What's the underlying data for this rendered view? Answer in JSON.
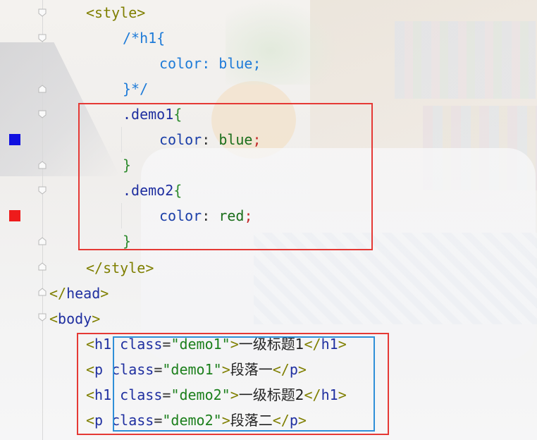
{
  "colors": {
    "red_box": "#e53935",
    "blue_box": "#2f8fd8",
    "blue_swatch": "#1010e0",
    "red_swatch": "#ee1b1b"
  },
  "code_lines": [
    {
      "parts": [
        {
          "t": "<",
          "c": "tag"
        },
        {
          "t": "style",
          "c": "tag"
        },
        {
          "t": ">",
          "c": "tag"
        }
      ]
    },
    {
      "parts": [
        {
          "t": "/*h1{",
          "c": "kw"
        }
      ]
    },
    {
      "parts": [
        {
          "t": "color: blue;",
          "c": "kw"
        }
      ]
    },
    {
      "parts": [
        {
          "t": "}*/",
          "c": "kw"
        }
      ]
    },
    {
      "parts": [
        {
          "t": ".demo1",
          "c": "sel"
        },
        {
          "t": "{",
          "c": "brace"
        }
      ]
    },
    {
      "parts": [
        {
          "t": "color",
          "c": "prop"
        },
        {
          "t": ": ",
          "c": "punc"
        },
        {
          "t": "blue",
          "c": "val"
        },
        {
          "t": ";",
          "c": "semi"
        }
      ]
    },
    {
      "parts": [
        {
          "t": "}",
          "c": "brace"
        }
      ]
    },
    {
      "parts": [
        {
          "t": ".demo2",
          "c": "sel"
        },
        {
          "t": "{",
          "c": "brace"
        }
      ]
    },
    {
      "parts": [
        {
          "t": "color",
          "c": "prop"
        },
        {
          "t": ": ",
          "c": "punc"
        },
        {
          "t": "red",
          "c": "val"
        },
        {
          "t": ";",
          "c": "semi"
        }
      ]
    },
    {
      "parts": [
        {
          "t": "}",
          "c": "brace"
        }
      ]
    },
    {
      "parts": [
        {
          "t": "</",
          "c": "tag"
        },
        {
          "t": "style",
          "c": "tag"
        },
        {
          "t": ">",
          "c": "tag"
        }
      ]
    },
    {
      "parts": [
        {
          "t": "</",
          "c": "tag"
        },
        {
          "t": "head",
          "c": "attr"
        },
        {
          "t": ">",
          "c": "tag"
        }
      ]
    },
    {
      "parts": [
        {
          "t": "<",
          "c": "tag"
        },
        {
          "t": "body",
          "c": "attr"
        },
        {
          "t": ">",
          "c": "tag"
        }
      ]
    },
    {
      "parts": [
        {
          "t": "<",
          "c": "tag"
        },
        {
          "t": "h1",
          "c": "attr"
        },
        {
          "t": " class",
          "c": "attr"
        },
        {
          "t": "=",
          "c": "punc"
        },
        {
          "t": "\"demo1\"",
          "c": "str"
        },
        {
          "t": ">",
          "c": "tag"
        },
        {
          "t": "一级标题1",
          "c": "cjk"
        },
        {
          "t": "</",
          "c": "tag"
        },
        {
          "t": "h1",
          "c": "attr"
        },
        {
          "t": ">",
          "c": "tag"
        }
      ]
    },
    {
      "parts": [
        {
          "t": "<",
          "c": "tag"
        },
        {
          "t": "p",
          "c": "attr"
        },
        {
          "t": " class",
          "c": "attr"
        },
        {
          "t": "=",
          "c": "punc"
        },
        {
          "t": "\"demo1\"",
          "c": "str"
        },
        {
          "t": ">",
          "c": "tag"
        },
        {
          "t": "段落一",
          "c": "cjk"
        },
        {
          "t": "</",
          "c": "tag"
        },
        {
          "t": "p",
          "c": "attr"
        },
        {
          "t": ">",
          "c": "tag"
        }
      ]
    },
    {
      "parts": [
        {
          "t": "<",
          "c": "tag"
        },
        {
          "t": "h1",
          "c": "attr"
        },
        {
          "t": " class",
          "c": "attr"
        },
        {
          "t": "=",
          "c": "punc"
        },
        {
          "t": "\"demo2\"",
          "c": "str"
        },
        {
          "t": ">",
          "c": "tag"
        },
        {
          "t": "一级标题2",
          "c": "cjk"
        },
        {
          "t": "</",
          "c": "tag"
        },
        {
          "t": "h1",
          "c": "attr"
        },
        {
          "t": ">",
          "c": "tag"
        }
      ]
    },
    {
      "parts": [
        {
          "t": "<",
          "c": "tag"
        },
        {
          "t": "p",
          "c": "attr"
        },
        {
          "t": " class",
          "c": "attr"
        },
        {
          "t": "=",
          "c": "punc"
        },
        {
          "t": "\"demo2\"",
          "c": "str"
        },
        {
          "t": ">",
          "c": "tag"
        },
        {
          "t": "段落二",
          "c": "cjk"
        },
        {
          "t": "</",
          "c": "tag"
        },
        {
          "t": "p",
          "c": "attr"
        },
        {
          "t": ">",
          "c": "tag"
        }
      ]
    }
  ]
}
